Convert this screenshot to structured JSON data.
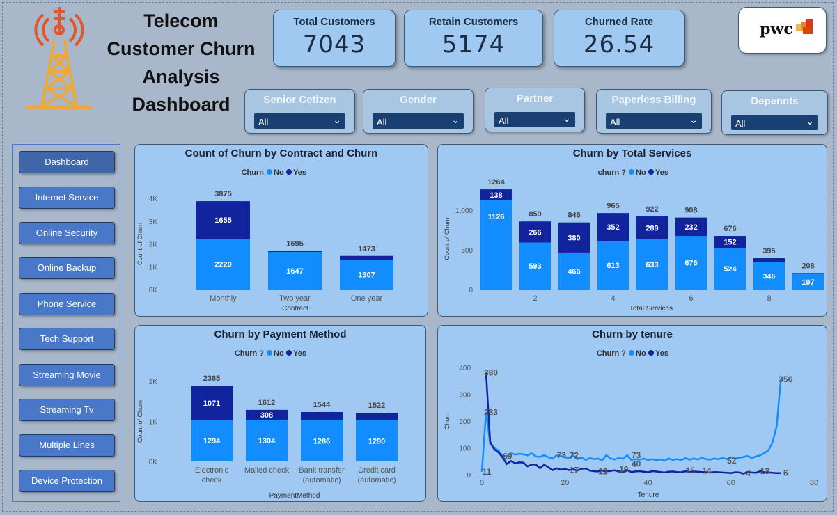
{
  "header": {
    "title_lines": [
      "Telecom",
      "Customer Churn",
      "Analysis",
      "Dashboard"
    ]
  },
  "kpis": [
    {
      "label": "Total Customers",
      "value": "7043"
    },
    {
      "label": "Retain Customers",
      "value": "5174"
    },
    {
      "label": "Churned Rate",
      "value": "26.54"
    }
  ],
  "logo": {
    "text": "pwc"
  },
  "slicers": [
    {
      "label": "Senior Cetizen",
      "value": "All"
    },
    {
      "label": "Gender",
      "value": "All"
    },
    {
      "label": "Partner",
      "value": "All"
    },
    {
      "label": "Paperless Billing",
      "value": "All"
    },
    {
      "label": "Depennts",
      "value": "All"
    }
  ],
  "nav": [
    "Dashboard",
    "Internet Service",
    "Online Security",
    "Online Backup",
    "Phone Service",
    "Tech Support",
    "Streaming Movie",
    "Streaming Tv",
    "Multiple Lines",
    "Device Protection"
  ],
  "colors": {
    "no": "#118dff",
    "yes": "#12239e"
  },
  "chart_data": [
    {
      "type": "bar",
      "title": "Count of Churn by Contract and Churn",
      "legend_title": "Churn",
      "legend": [
        "No",
        "Yes"
      ],
      "xlabel": "Contract",
      "ylabel": "Count of Churn",
      "ylim": [
        0,
        4000
      ],
      "yticks": [
        "0K",
        "1K",
        "2K",
        "3K",
        "4K"
      ],
      "categories": [
        "Monthly",
        "Two year",
        "One year"
      ],
      "series": [
        {
          "name": "No",
          "values": [
            2220,
            1647,
            1307
          ]
        },
        {
          "name": "Yes",
          "values": [
            1655,
            48,
            166
          ]
        }
      ],
      "totals": [
        3875,
        1695,
        1473
      ]
    },
    {
      "type": "bar",
      "title": "Churn by Total Services",
      "legend_title": "churn ?",
      "legend": [
        "No",
        "Yes"
      ],
      "xlabel": "Total Services",
      "ylabel": "Count of Churn",
      "ylim": [
        0,
        1300
      ],
      "yticks": [
        "0",
        "500",
        "1,000"
      ],
      "xticks": [
        "2",
        "4",
        "6",
        "8"
      ],
      "categories": [
        1,
        2,
        3,
        4,
        5,
        6,
        7,
        8,
        9
      ],
      "series": [
        {
          "name": "No",
          "values": [
            1126,
            593,
            466,
            613,
            633,
            676,
            524,
            346,
            197
          ]
        },
        {
          "name": "Yes",
          "values": [
            138,
            266,
            380,
            352,
            289,
            232,
            152,
            49,
            11
          ]
        }
      ],
      "totals": [
        1264,
        859,
        846,
        965,
        922,
        908,
        676,
        395,
        208
      ]
    },
    {
      "type": "bar",
      "title": "Churn by Payment Method",
      "legend_title": "Churn ?",
      "legend": [
        "No",
        "Yes"
      ],
      "xlabel": "PaymentMethod",
      "ylabel": "Count of Churn",
      "ylim": [
        0,
        2500
      ],
      "yticks": [
        "0K",
        "1K",
        "2K"
      ],
      "categories": [
        [
          "Electronic",
          "check"
        ],
        [
          "Mailed check"
        ],
        [
          "Bank transfer",
          "(automatic)"
        ],
        [
          "Credit card",
          "(automatic)"
        ]
      ],
      "series": [
        {
          "name": "No",
          "values": [
            1294,
            1304,
            1286,
            1290
          ]
        },
        {
          "name": "Yes",
          "values": [
            1071,
            308,
            258,
            232
          ]
        }
      ],
      "totals": [
        2365,
        1612,
        1544,
        1522
      ]
    },
    {
      "type": "line",
      "title": "Churn by tenure",
      "legend_title": "Churn ?",
      "legend": [
        "No",
        "Yes"
      ],
      "xlabel": "Tenure",
      "ylabel": "Churn",
      "xlim": [
        0,
        80
      ],
      "ylim": [
        0,
        400
      ],
      "xticks": [
        "0",
        "20",
        "40",
        "60",
        "80"
      ],
      "yticks": [
        "0",
        "100",
        "200",
        "300",
        "400"
      ],
      "series": [
        {
          "name": "No",
          "points": [
            [
              0,
              11
            ],
            [
              1,
              233
            ],
            [
              2,
              115
            ],
            [
              3,
              100
            ],
            [
              4,
              90
            ],
            [
              5,
              70
            ],
            [
              6,
              69
            ],
            [
              7,
              80
            ],
            [
              8,
              75
            ],
            [
              9,
              78
            ],
            [
              10,
              76
            ],
            [
              11,
              72
            ],
            [
              12,
              80
            ],
            [
              13,
              68
            ],
            [
              14,
              66
            ],
            [
              15,
              73
            ],
            [
              16,
              65
            ],
            [
              17,
              60
            ],
            [
              18,
              72
            ],
            [
              19,
              70
            ],
            [
              20,
              65
            ],
            [
              21,
              62
            ],
            [
              22,
              72
            ],
            [
              23,
              58
            ],
            [
              24,
              64
            ],
            [
              25,
              55
            ],
            [
              26,
              62
            ],
            [
              27,
              58
            ],
            [
              28,
              60
            ],
            [
              29,
              54
            ],
            [
              30,
              73
            ],
            [
              31,
              60
            ],
            [
              32,
              57
            ],
            [
              33,
              62
            ],
            [
              34,
              59
            ],
            [
              35,
              73
            ],
            [
              36,
              55
            ],
            [
              37,
              58
            ],
            [
              38,
              56
            ],
            [
              39,
              60
            ],
            [
              40,
              55
            ],
            [
              41,
              58
            ],
            [
              42,
              54
            ],
            [
              43,
              57
            ],
            [
              44,
              52
            ],
            [
              45,
              60
            ],
            [
              46,
              55
            ],
            [
              47,
              58
            ],
            [
              48,
              54
            ],
            [
              49,
              62
            ],
            [
              50,
              56
            ],
            [
              51,
              60
            ],
            [
              52,
              57
            ],
            [
              53,
              62
            ],
            [
              54,
              58
            ],
            [
              55,
              56
            ],
            [
              56,
              60
            ],
            [
              57,
              58
            ],
            [
              58,
              62
            ],
            [
              59,
              58
            ],
            [
              60,
              65
            ],
            [
              61,
              60
            ],
            [
              62,
              63
            ],
            [
              63,
              66
            ],
            [
              64,
              70
            ],
            [
              65,
              62
            ],
            [
              66,
              68
            ],
            [
              67,
              72
            ],
            [
              68,
              80
            ],
            [
              69,
              90
            ],
            [
              70,
              120
            ],
            [
              71,
              180
            ],
            [
              72,
              356
            ]
          ]
        },
        {
          "name": "Yes",
          "points": [
            [
              1,
              380
            ],
            [
              2,
              123
            ],
            [
              3,
              94
            ],
            [
              4,
              83
            ],
            [
              5,
              64
            ],
            [
              6,
              40
            ],
            [
              7,
              51
            ],
            [
              8,
              42
            ],
            [
              9,
              46
            ],
            [
              10,
              45
            ],
            [
              11,
              31
            ],
            [
              12,
              38
            ],
            [
              13,
              38
            ],
            [
              14,
              24
            ],
            [
              15,
              37
            ],
            [
              16,
              28
            ],
            [
              17,
              17
            ],
            [
              18,
              24
            ],
            [
              19,
              19
            ],
            [
              20,
              21
            ],
            [
              21,
              17
            ],
            [
              22,
              20
            ],
            [
              23,
              15
            ],
            [
              24,
              22
            ],
            [
              25,
              23
            ],
            [
              26,
              15
            ],
            [
              27,
              13
            ],
            [
              28,
              12
            ],
            [
              29,
              15
            ],
            [
              30,
              12
            ],
            [
              31,
              14
            ],
            [
              32,
              16
            ],
            [
              33,
              12
            ],
            [
              34,
              10
            ],
            [
              35,
              17
            ],
            [
              36,
              10
            ],
            [
              37,
              12
            ],
            [
              38,
              13
            ],
            [
              39,
              11
            ],
            [
              40,
              9
            ],
            [
              41,
              13
            ],
            [
              42,
              12
            ],
            [
              43,
              10
            ],
            [
              44,
              8
            ],
            [
              45,
              11
            ],
            [
              46,
              12
            ],
            [
              47,
              10
            ],
            [
              48,
              9
            ],
            [
              49,
              13
            ],
            [
              50,
              10
            ],
            [
              51,
              12
            ],
            [
              52,
              11
            ],
            [
              53,
              10
            ],
            [
              54,
              9
            ],
            [
              55,
              8
            ],
            [
              56,
              10
            ],
            [
              57,
              9
            ],
            [
              58,
              8
            ],
            [
              59,
              7
            ],
            [
              60,
              6
            ],
            [
              61,
              9
            ],
            [
              62,
              8
            ],
            [
              63,
              4
            ],
            [
              64,
              10
            ],
            [
              65,
              8
            ],
            [
              66,
              7
            ],
            [
              67,
              13
            ],
            [
              68,
              9
            ],
            [
              69,
              8
            ],
            [
              70,
              7
            ],
            [
              71,
              6
            ],
            [
              72,
              6
            ]
          ]
        }
      ],
      "annotations": [
        {
          "x": 1,
          "y": 380,
          "text": "380"
        },
        {
          "x": 1,
          "y": 233,
          "text": "233"
        },
        {
          "x": 0,
          "y": 11,
          "text": "11"
        },
        {
          "x": 5,
          "y": 69,
          "text": "69"
        },
        {
          "x": 18,
          "y": 73,
          "text": "73"
        },
        {
          "x": 21,
          "y": 72,
          "text": "72"
        },
        {
          "x": 21,
          "y": 17,
          "text": "17"
        },
        {
          "x": 28,
          "y": 12,
          "text": "12"
        },
        {
          "x": 33,
          "y": 19,
          "text": "19"
        },
        {
          "x": 36,
          "y": 73,
          "text": "73"
        },
        {
          "x": 36,
          "y": 40,
          "text": "40"
        },
        {
          "x": 49,
          "y": 15,
          "text": "15"
        },
        {
          "x": 53,
          "y": 14,
          "text": "14"
        },
        {
          "x": 59,
          "y": 52,
          "text": "52"
        },
        {
          "x": 63,
          "y": 4,
          "text": "4"
        },
        {
          "x": 67,
          "y": 13,
          "text": "13"
        },
        {
          "x": 72,
          "y": 6,
          "text": "6"
        },
        {
          "x": 72,
          "y": 356,
          "text": "356"
        }
      ]
    }
  ]
}
